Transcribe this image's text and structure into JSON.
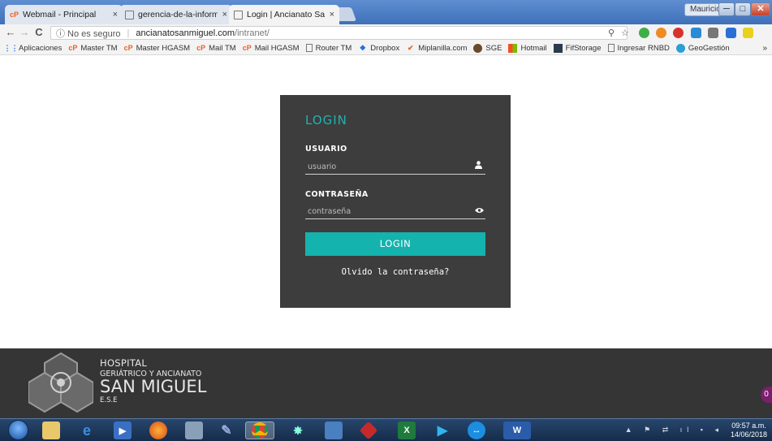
{
  "browser": {
    "tabs": [
      {
        "title": "Webmail - Principal",
        "close": "×"
      },
      {
        "title": "gerencia-de-la-informació",
        "close": "×"
      },
      {
        "title": "Login | Ancianato San Mi",
        "close": "×"
      }
    ],
    "user": "Mauricio",
    "window_buttons": {
      "minimize": "─",
      "maximize": "□",
      "close": "✕"
    },
    "address": {
      "security": "ⓘ No es seguro",
      "separator": "|",
      "host": "ancianatosanmiguel.com",
      "path": "/intranet/"
    },
    "nav": {
      "back": "←",
      "forward": "→",
      "reload": "C"
    },
    "bookmarks": [
      {
        "label": "Aplicaciones",
        "icon": "apps-icon"
      },
      {
        "label": "Master TM",
        "icon": "cpanel-icon"
      },
      {
        "label": "Master HGASM",
        "icon": "cpanel-icon"
      },
      {
        "label": "Mail TM",
        "icon": "cpanel-icon"
      },
      {
        "label": "Mail HGASM",
        "icon": "cpanel-icon"
      },
      {
        "label": "Router TM",
        "icon": "page-icon"
      },
      {
        "label": "Dropbox",
        "icon": "dropbox-icon"
      },
      {
        "label": "Miplanilla.com",
        "icon": "check-icon"
      },
      {
        "label": "SGE",
        "icon": "sge-icon"
      },
      {
        "label": "Hotmail",
        "icon": "windows-icon"
      },
      {
        "label": "FifStorage",
        "icon": "storage-icon"
      },
      {
        "label": "Ingresar RNBD",
        "icon": "page-icon"
      },
      {
        "label": "GeoGestión",
        "icon": "geo-icon"
      }
    ],
    "bookmarks_more": "»"
  },
  "login": {
    "title": "LOGIN",
    "username_label": "USUARIO",
    "username_placeholder": "usuario",
    "password_label": "CONTRASEÑA",
    "password_placeholder": "contraseña",
    "button": "LOGIN",
    "forgot": "Olvido la contraseña?"
  },
  "footer": {
    "line1": "HOSPITAL",
    "line2": "GERIÁTRICO Y ANCIANATO",
    "line3": "SAN MIGUEL",
    "line4": "E.S.E",
    "chat_badge": "0"
  },
  "taskbar": {
    "time": "09:57 a.m.",
    "date": "14/06/2018"
  },
  "colors": {
    "accent": "#14b3ad",
    "card": "#3d3d3d",
    "footer": "#353535"
  }
}
